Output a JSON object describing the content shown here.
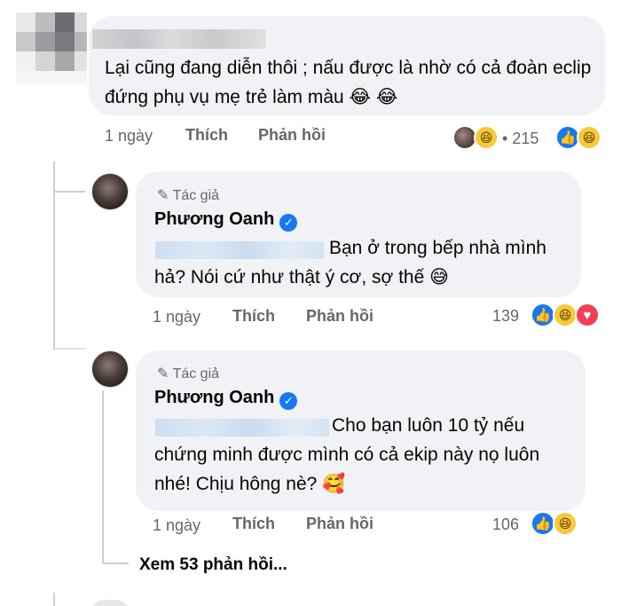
{
  "comment": {
    "text": "Lại cũng đang diễn thôi ; nấu được là nhờ có cả đoàn eclip đứng phụ vụ mẹ trẻ làm màu 😂 😂",
    "time": "1 ngày",
    "like": "Thích",
    "reply": "Phản hồi",
    "reaction_count": "• 215"
  },
  "replies": [
    {
      "badge": "Tác giả",
      "author": "Phương Oanh",
      "text": "Bạn ở trong bếp nhà mình hả? Nói cứ như thật ý cơ, sợ thế 😅",
      "time": "1 ngày",
      "like": "Thích",
      "reply": "Phản hồi",
      "reaction_count": "139"
    },
    {
      "badge": "Tác giả",
      "author": "Phương Oanh",
      "text": "Cho bạn luôn 10 tỷ nếu chứng minh được mình có cả ekip này nọ luôn nhé! Chịu hông nè? 🥰",
      "time": "1 ngày",
      "like": "Thích",
      "reply": "Phản hồi",
      "reaction_count": "106"
    }
  ],
  "view_more": "Xem 53 phản hồi...",
  "icons": {
    "like": "👍",
    "haha": "😆",
    "love": "♥",
    "verified": "✓",
    "pen": "✎"
  }
}
